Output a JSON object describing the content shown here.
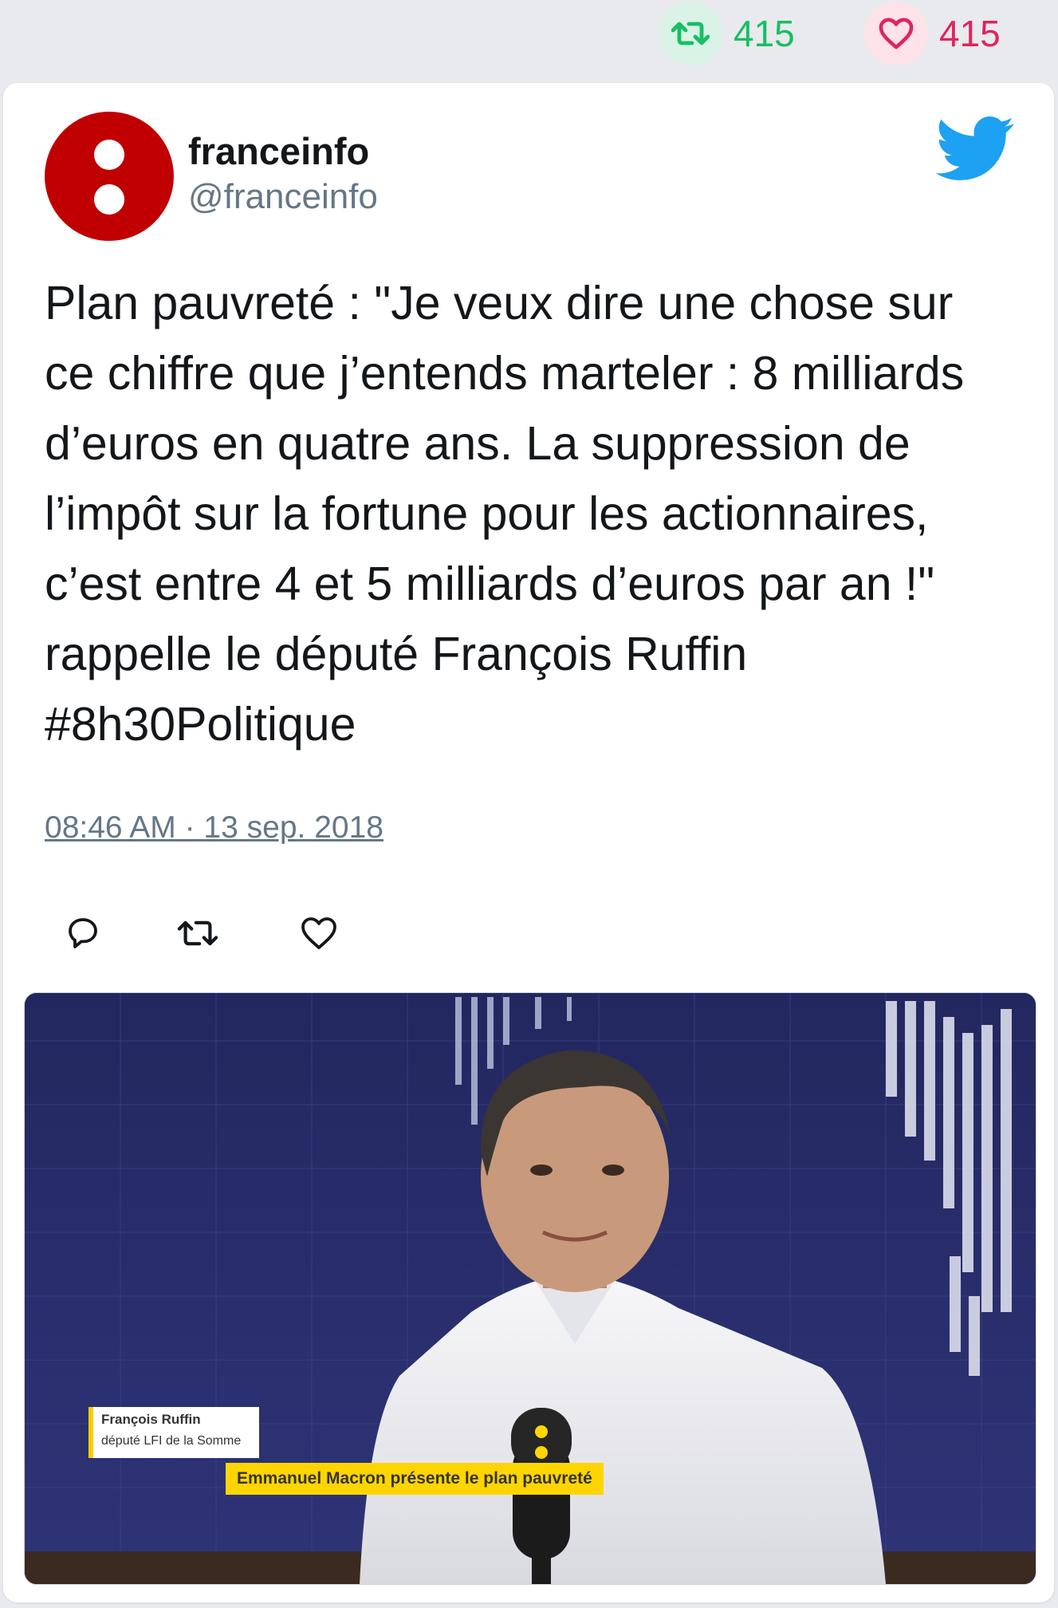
{
  "top_stats": {
    "retweets": "415",
    "likes": "415",
    "retweet_color": "#17bf63",
    "like_color": "#e0245e"
  },
  "tweet": {
    "author_name": "franceinfo",
    "author_handle": "@franceinfo",
    "text": "Plan pauvreté : \"Je veux dire une chose sur ce chiffre que j’entends marteler : 8 milliards d’euros en quatre ans. La suppression de l’impôt sur la fortune pour les actionnaires, c’est entre 4 et 5 milliards d’euros par an !\" rappelle le député François Ruffin #8h30Politique",
    "timestamp": "08:46 AM · 13 sep. 2018",
    "icons": [
      "reply-icon",
      "retweet-icon",
      "like-icon",
      "twitter-bird-icon"
    ],
    "brand_color": "#c00000"
  },
  "media": {
    "caption_name": "François Ruffin",
    "caption_role": "député LFI de la Somme",
    "caption_headline": "Emmanuel Macron présente le plan pauvreté"
  }
}
